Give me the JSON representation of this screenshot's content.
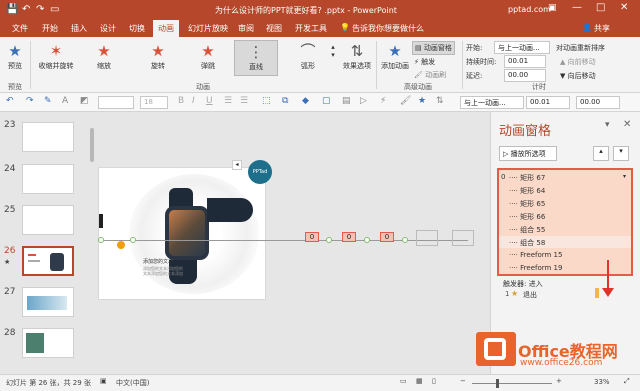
{
  "window": {
    "title": "为什么设计师的PPT就更好看? .pptx  -  PowerPoint",
    "account": "pptad.com",
    "share": "共享"
  },
  "tabs": [
    "文件",
    "开始",
    "插入",
    "设计",
    "切换",
    "动画",
    "幻灯片放映",
    "审阅",
    "视图",
    "开发工具"
  ],
  "tell_me": "告诉我你想要做什么",
  "ribbon": {
    "preview": "预览",
    "effects": [
      "收缩并旋转",
      "缩放",
      "旋转",
      "弹跳",
      "直线",
      "弧形"
    ],
    "effect_options": "效果选项",
    "add_animation": "添加动画",
    "animation_pane": "动画窗格",
    "trigger": "触发",
    "animation_painter": "动画刷",
    "start_label": "开始:",
    "start_value": "与上一动画...",
    "duration_label": "持续时间:",
    "duration_value": "00.01",
    "delay_label": "延迟:",
    "delay_value": "00.00",
    "reorder": "对动画重新排序",
    "move_earlier": "向前移动",
    "move_later": "向后移动",
    "groups": {
      "preview": "预览",
      "animation": "动画",
      "advanced": "高级动画",
      "timing": "计时"
    }
  },
  "toolbar": {
    "font_size": "18",
    "start_value": "与上一动画...",
    "duration": "00.01",
    "delay": "00.00"
  },
  "slides": [
    {
      "n": "23"
    },
    {
      "n": "24"
    },
    {
      "n": "25"
    },
    {
      "n": "26",
      "star": "★"
    },
    {
      "n": "27"
    },
    {
      "n": "28"
    }
  ],
  "slide": {
    "logo": "PPTad",
    "badge_text": "添加您的文本",
    "sub_text": "添加您的文本添加您的文本添加您的文本添加"
  },
  "path_boxes": [
    "0",
    "0",
    "0"
  ],
  "pane": {
    "title": "动画窗格",
    "play_all": "播放所选项",
    "items": [
      "矩形 67",
      "矩形 64",
      "矩形 65",
      "矩形 66",
      "组合 55",
      "组合 58",
      "Freeform 15",
      "Freeform 19"
    ],
    "first_index": "0",
    "trigger_label": "触发器: 进入",
    "exit_label": "退出",
    "exit_num": "1"
  },
  "status": {
    "slide_info": "幻灯片 第 26 张，共 29 张",
    "language": "中文(中国)",
    "zoom": "33%"
  },
  "watermark": {
    "site": "Office教程网",
    "url": "www.office26.com"
  },
  "colors": {
    "accent": "#b7472a",
    "highlight": "#e45b4a",
    "list_bg": "#fbd9c8"
  }
}
